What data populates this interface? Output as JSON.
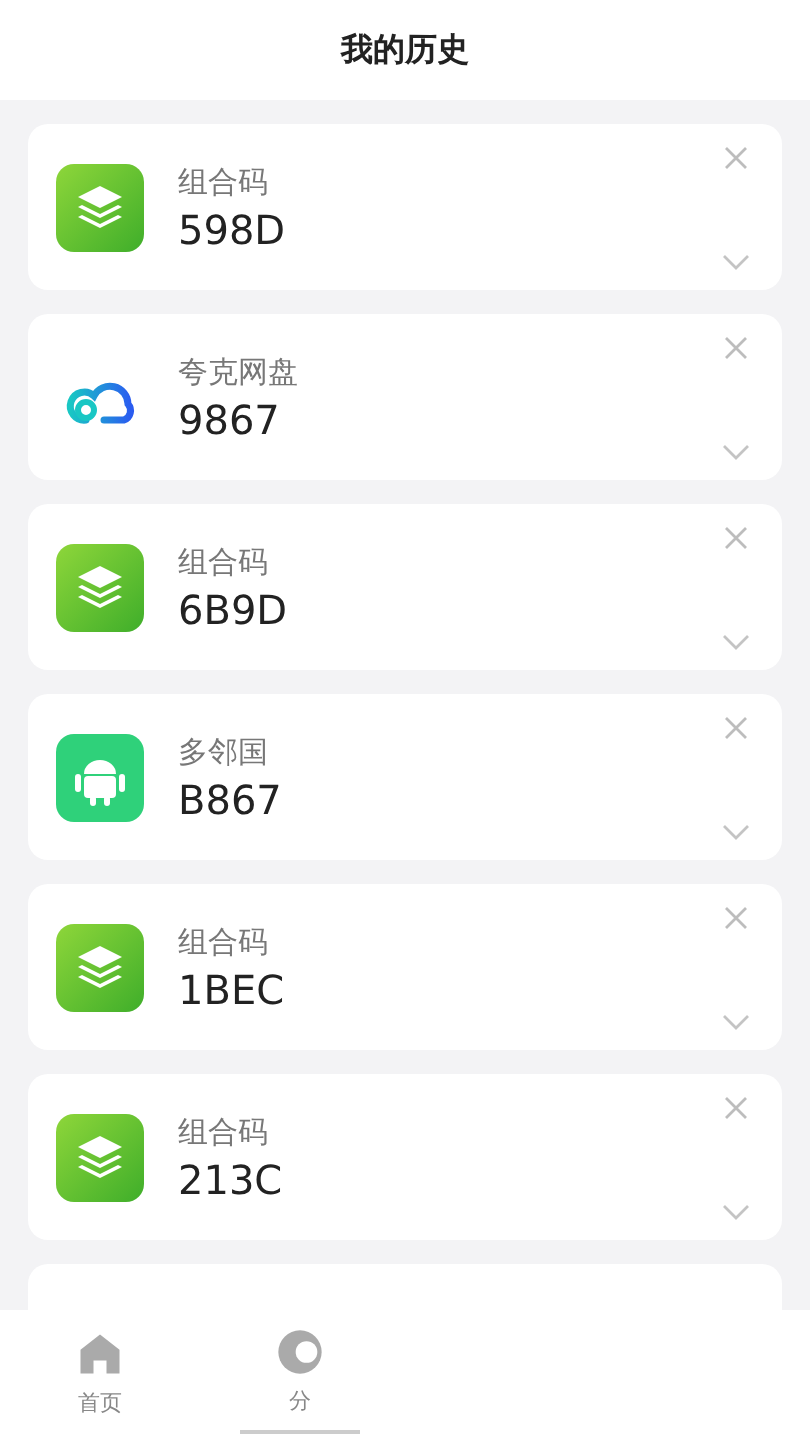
{
  "header": {
    "title": "我的历史"
  },
  "history": [
    {
      "kind": "stack",
      "name": "组合码",
      "code": "598D"
    },
    {
      "kind": "cloud",
      "name": "夸克网盘",
      "code": "9867"
    },
    {
      "kind": "stack",
      "name": "组合码",
      "code": "6B9D"
    },
    {
      "kind": "android",
      "name": "多邻国",
      "code": "B867"
    },
    {
      "kind": "stack",
      "name": "组合码",
      "code": "1BEC"
    },
    {
      "kind": "stack",
      "name": "组合码",
      "code": "213C"
    },
    {
      "kind": "blank"
    }
  ],
  "tab_bar": [
    {
      "kind": "home",
      "label": "首页",
      "selected": false
    },
    {
      "kind": "category",
      "label": "分",
      "selected": true
    }
  ]
}
